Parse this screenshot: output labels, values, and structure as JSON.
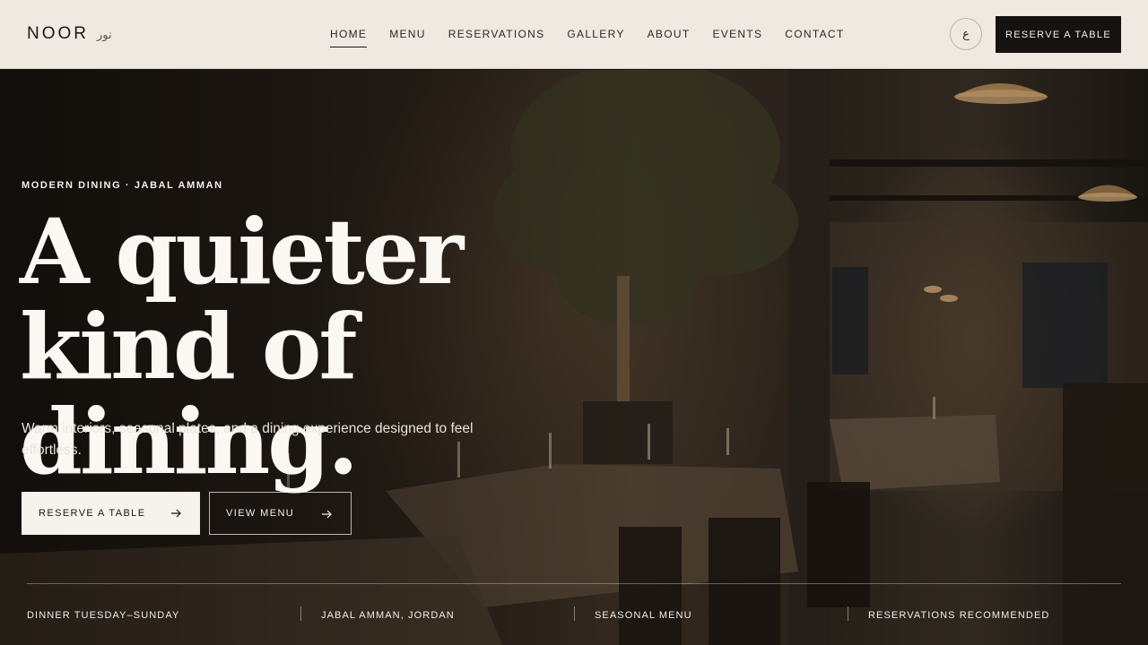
{
  "brand": {
    "name": "NOOR",
    "name_arabic": "نور"
  },
  "nav": {
    "items": [
      {
        "label": "HOME",
        "active": true
      },
      {
        "label": "MENU",
        "active": false
      },
      {
        "label": "RESERVATIONS",
        "active": false
      },
      {
        "label": "GALLERY",
        "active": false
      },
      {
        "label": "ABOUT",
        "active": false
      },
      {
        "label": "EVENTS",
        "active": false
      },
      {
        "label": "CONTACT",
        "active": false
      }
    ]
  },
  "header": {
    "language_toggle": "ع",
    "cta_label": "RESERVE A TABLE"
  },
  "hero": {
    "eyebrow": "MODERN DINING · JABAL AMMAN",
    "headline_line1": "A quieter kind of",
    "headline_line2": "dining.",
    "subtext": "Warm interiors, seasonal plates, and a dining experience designed to feel effortless.",
    "primary_button": "RESERVE A TABLE",
    "secondary_button": "VIEW MENU",
    "background_icon": "restaurant-interior-photo"
  },
  "info_bar": {
    "items": [
      "DINNER TUESDAY–SUNDAY",
      "JABAL AMMAN, JORDAN",
      "SEASONAL MENU",
      "RESERVATIONS RECOMMENDED"
    ]
  },
  "colors": {
    "header_bg": "#efe9e2",
    "dark": "#15120f",
    "light_text": "#f3efe9"
  }
}
